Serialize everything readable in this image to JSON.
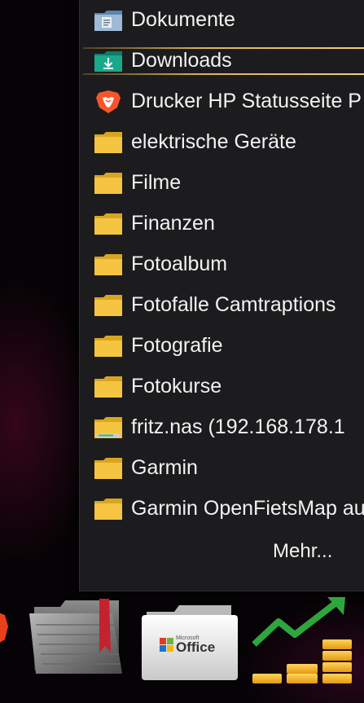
{
  "stack_menu": {
    "items": [
      {
        "label": "Dokumente",
        "icon": "document-folder-icon"
      },
      {
        "label": "Downloads",
        "icon": "downloads-folder-icon",
        "selected": true
      },
      {
        "label": "Drucker HP Statusseite P",
        "icon": "brave-browser-icon"
      },
      {
        "label": "elektrische Geräte",
        "icon": "folder-icon"
      },
      {
        "label": "Filme",
        "icon": "folder-icon"
      },
      {
        "label": "Finanzen",
        "icon": "folder-icon"
      },
      {
        "label": "Fotoalbum",
        "icon": "folder-icon"
      },
      {
        "label": "Fotofalle Camtraptions",
        "icon": "folder-icon"
      },
      {
        "label": "Fotografie",
        "icon": "folder-icon"
      },
      {
        "label": "Fotokurse",
        "icon": "folder-icon"
      },
      {
        "label": "fritz.nas (192.168.178.1",
        "icon": "network-drive-icon"
      },
      {
        "label": "Garmin",
        "icon": "folder-icon"
      },
      {
        "label": "Garmin OpenFietsMap au",
        "icon": "folder-icon"
      }
    ],
    "more_label": "Mehr..."
  },
  "dock": {
    "items": [
      {
        "name": "brave-browser-icon"
      },
      {
        "name": "stacks-folder-icon"
      },
      {
        "name": "microsoft-office-folder-icon",
        "text_logo": "Office",
        "text_small": "Microsoft"
      },
      {
        "name": "finance-chart-icon"
      }
    ]
  },
  "colors": {
    "menu_bg": "#1c1c1e",
    "selection_gold": "#d9b45a",
    "folder_yellow": "#f5c542",
    "text": "#f2f2f2"
  }
}
